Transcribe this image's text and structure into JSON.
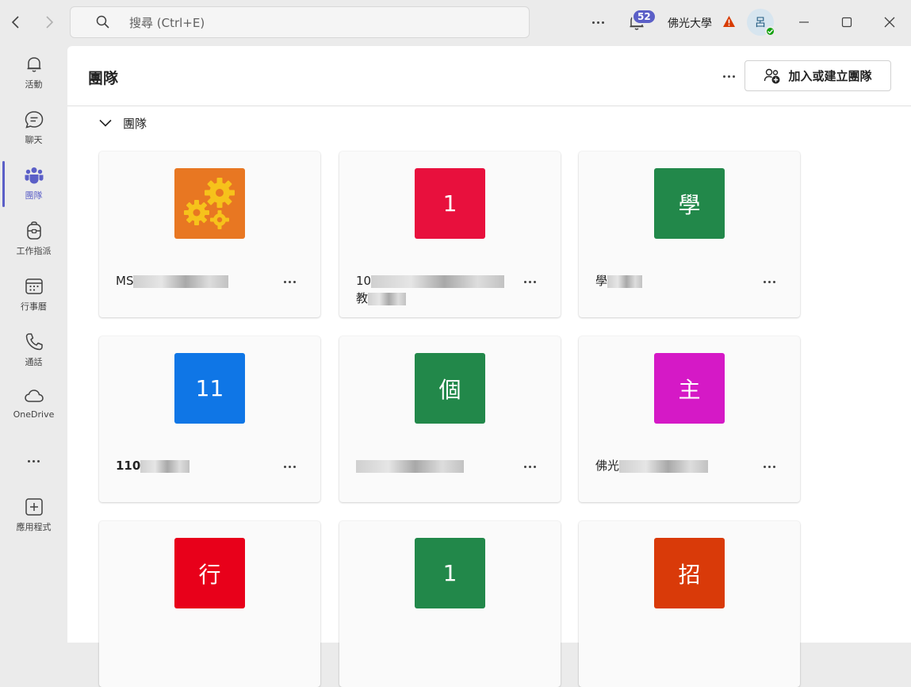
{
  "titlebar": {
    "search_placeholder": "搜尋 (Ctrl+E)",
    "notification_count": "52",
    "org_name": "佛光大學",
    "avatar_initial": "呂"
  },
  "rail": {
    "items": [
      {
        "label": "活動",
        "icon": "bell-icon"
      },
      {
        "label": "聊天",
        "icon": "chat-icon"
      },
      {
        "label": "團隊",
        "icon": "teams-icon"
      },
      {
        "label": "工作指派",
        "icon": "backpack-icon"
      },
      {
        "label": "行事曆",
        "icon": "calendar-icon"
      },
      {
        "label": "通話",
        "icon": "phone-icon"
      },
      {
        "label": "OneDrive",
        "icon": "cloud-icon"
      },
      {
        "label": "應用程式",
        "icon": "add-app-icon"
      }
    ],
    "active": "團隊"
  },
  "main": {
    "title": "團隊",
    "join_button": "加入或建立團隊",
    "section_label": "團隊"
  },
  "cards": [
    {
      "tile_text": "",
      "tile_color": "#e87722",
      "name_visible": "MS",
      "name_visible_2": ""
    },
    {
      "tile_text": "1",
      "tile_color": "#e8103d",
      "name_visible": "10",
      "name_visible_2": "教"
    },
    {
      "tile_text": "學",
      "tile_color": "#22884a",
      "name_visible": "學",
      "name_visible_2": ""
    },
    {
      "tile_text": "11",
      "tile_color": "#0f76e6",
      "name_visible": "110",
      "name_visible_2": ""
    },
    {
      "tile_text": "個",
      "tile_color": "#22884a",
      "name_visible": "",
      "name_visible_2": ""
    },
    {
      "tile_text": "主",
      "tile_color": "#d519c6",
      "name_visible": "佛光",
      "name_visible_2": ""
    },
    {
      "tile_text": "行",
      "tile_color": "#e8001a",
      "name_visible": "",
      "name_visible_2": ""
    },
    {
      "tile_text": "1",
      "tile_color": "#22884a",
      "name_visible": "",
      "name_visible_2": ""
    },
    {
      "tile_text": "招",
      "tile_color": "#d93a09",
      "name_visible": "",
      "name_visible_2": ""
    }
  ],
  "colors": {
    "accent": "#5b5fc7",
    "presence": "#13a10e",
    "warning": "#d83b01"
  }
}
